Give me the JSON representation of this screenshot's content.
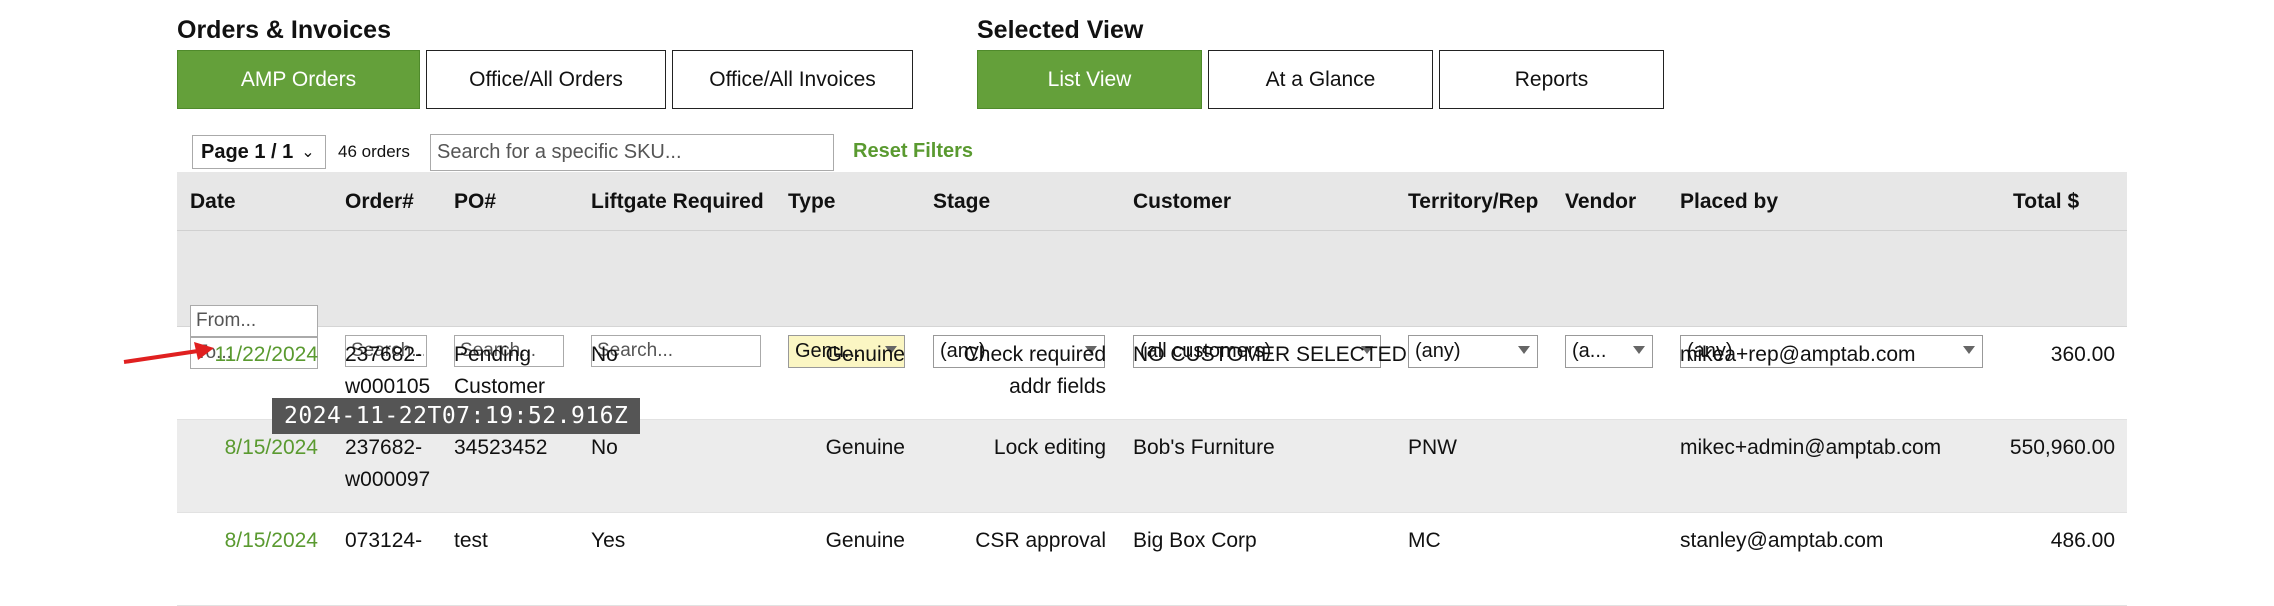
{
  "orders_section": {
    "title": "Orders & Invoices",
    "tabs": [
      "AMP Orders",
      "Office/All Orders",
      "Office/All Invoices"
    ]
  },
  "view_section": {
    "title": "Selected View",
    "tabs": [
      "List View",
      "At a Glance",
      "Reports"
    ]
  },
  "toolbar": {
    "page_selector": "Page 1 / 1",
    "order_count": "46 orders",
    "sku_placeholder": "Search for a specific SKU...",
    "reset_filters": "Reset Filters"
  },
  "table": {
    "columns": [
      "Date",
      "Order#",
      "PO#",
      "Liftgate Required",
      "Type",
      "Stage",
      "Customer",
      "Territory/Rep",
      "Vendor",
      "Placed by",
      "Total $"
    ],
    "filters": {
      "date_from": "From...",
      "date_to": "To...",
      "order_search": "Search...",
      "po_search": "Search...",
      "liftgate_search": "Search...",
      "type": "Genu...",
      "stage": "(any)",
      "customer": "(all customers)",
      "territory": "(any)",
      "vendor": "(a...",
      "placed_by": "(any)"
    },
    "rows": [
      {
        "date": "11/22/2024",
        "order1": "237682-",
        "order2": "w000105",
        "po1": "Pending",
        "po2": "Customer",
        "liftgate": "No",
        "type": "Genuine",
        "stage1": "Check required",
        "stage2": "addr fields",
        "customer": "NO CUSTOMER SELECTED",
        "territory": "",
        "vendor": "",
        "placed_by": "mikea+rep@amptab.com",
        "total": "360.00"
      },
      {
        "date": "8/15/2024",
        "order1": "237682-",
        "order2": "w000097",
        "po1": "34523452",
        "po2": "",
        "liftgate": "No",
        "type": "Genuine",
        "stage1": "Lock editing",
        "stage2": "",
        "customer": "Bob's Furniture",
        "territory": "PNW",
        "vendor": "",
        "placed_by": "mikec+admin@amptab.com",
        "total": "550,960.00"
      },
      {
        "date": "8/15/2024",
        "order1": "073124-",
        "order2": "",
        "po1": "test",
        "po2": "",
        "liftgate": "Yes",
        "type": "Genuine",
        "stage1": "CSR approval",
        "stage2": "",
        "customer": "Big Box Corp",
        "territory": "MC",
        "vendor": "",
        "placed_by": "stanley@amptab.com",
        "total": "486.00"
      }
    ]
  },
  "tooltip": "2024-11-22T07:19:52.916Z",
  "colors": {
    "accent": "#64a03a",
    "link": "#5a9a30",
    "annotation_arrow": "#e02020"
  }
}
